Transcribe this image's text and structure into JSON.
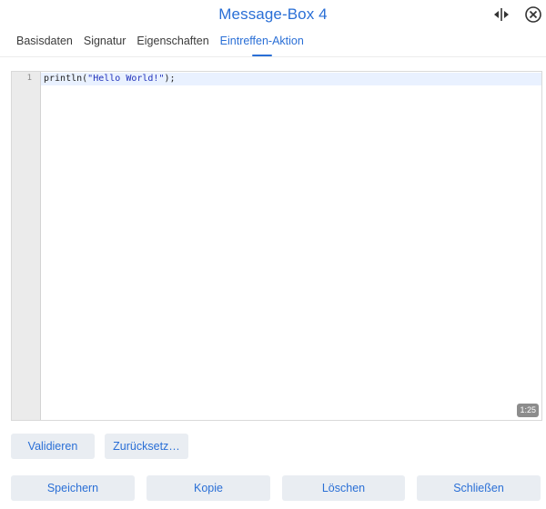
{
  "header": {
    "title": "Message-Box 4",
    "icons": {
      "resize": "resize-horizontal-icon",
      "close": "close-circle-icon"
    }
  },
  "tabs": [
    {
      "label": "Basisdaten",
      "active": false
    },
    {
      "label": "Signatur",
      "active": false
    },
    {
      "label": "Eigenschaften",
      "active": false
    },
    {
      "label": "Eintreffen-Aktion",
      "active": true
    }
  ],
  "editor": {
    "lines": [
      {
        "number": "1",
        "code_prefix": "println(",
        "code_string": "\"Hello World!\"",
        "code_suffix": ");"
      }
    ],
    "cursor_position": "1:25"
  },
  "actions": {
    "validate_label": "Validieren",
    "reset_label": "Zurücksetz…"
  },
  "footer": {
    "save_label": "Speichern",
    "copy_label": "Kopie",
    "delete_label": "Löschen",
    "close_label": "Schließen"
  },
  "colors": {
    "accent": "#2a6fd6",
    "button_bg": "#e9edf2",
    "gutter_bg": "#ebebeb",
    "active_line_bg": "#e9f1ff",
    "string_token": "#2233bb"
  }
}
